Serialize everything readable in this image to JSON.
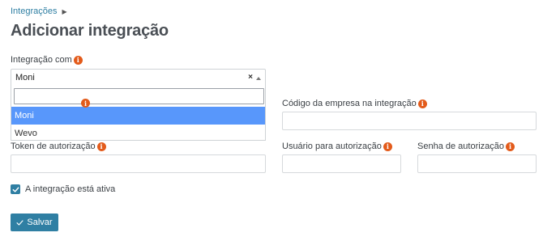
{
  "breadcrumb": {
    "item": "Integrações"
  },
  "page": {
    "title": "Adicionar integração"
  },
  "form": {
    "integration_with": {
      "label": "Integração com",
      "value": "Moni",
      "clear": "×",
      "options": [
        "Moni",
        "Wevo"
      ]
    },
    "company_code": {
      "label": "Código da empresa na integração"
    },
    "auth_token": {
      "label": "Token de autorização"
    },
    "auth_user": {
      "label": "Usuário para autorização"
    },
    "auth_password": {
      "label": "Senha de autorização"
    },
    "active": {
      "label": "A integração está ativa",
      "checked": true
    },
    "save": {
      "label": "Salvar"
    }
  },
  "colors": {
    "accent": "#2f7fa3",
    "info_icon": "#e35b1b",
    "highlight": "#5897fb"
  },
  "icons": {
    "info": "info-circle-icon",
    "check": "check-icon",
    "chevron": "chevron-right-icon"
  }
}
